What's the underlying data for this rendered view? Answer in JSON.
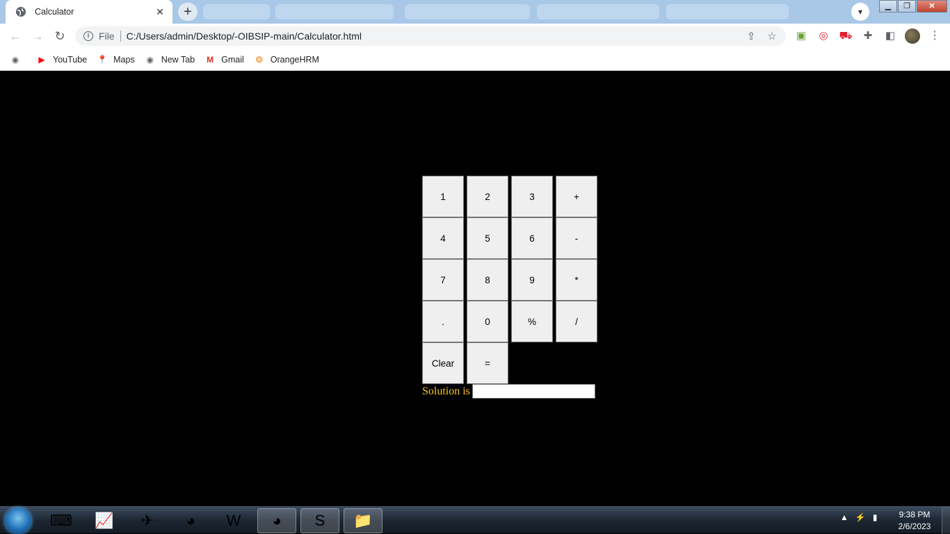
{
  "browser": {
    "tab_title": "Calculator",
    "url_scheme": "File",
    "url": "C:/Users/admin/Desktop/-OIBSIP-main/Calculator.html",
    "bookmarks": [
      "YouTube",
      "Maps",
      "New Tab",
      "Gmail",
      "OrangeHRM"
    ]
  },
  "calculator": {
    "keys": [
      "1",
      "2",
      "3",
      "+",
      "4",
      "5",
      "6",
      "-",
      "7",
      "8",
      "9",
      "*",
      ".",
      "0",
      "%",
      "/",
      "Clear",
      "="
    ],
    "solution_label": "Solution is",
    "solution_value": ""
  },
  "taskbar": {
    "time": "9:38 PM",
    "date": "2/6/2023"
  },
  "colors": {
    "page_background": "#000000",
    "solution_label": "#f5c518",
    "key_background": "#efefef"
  }
}
